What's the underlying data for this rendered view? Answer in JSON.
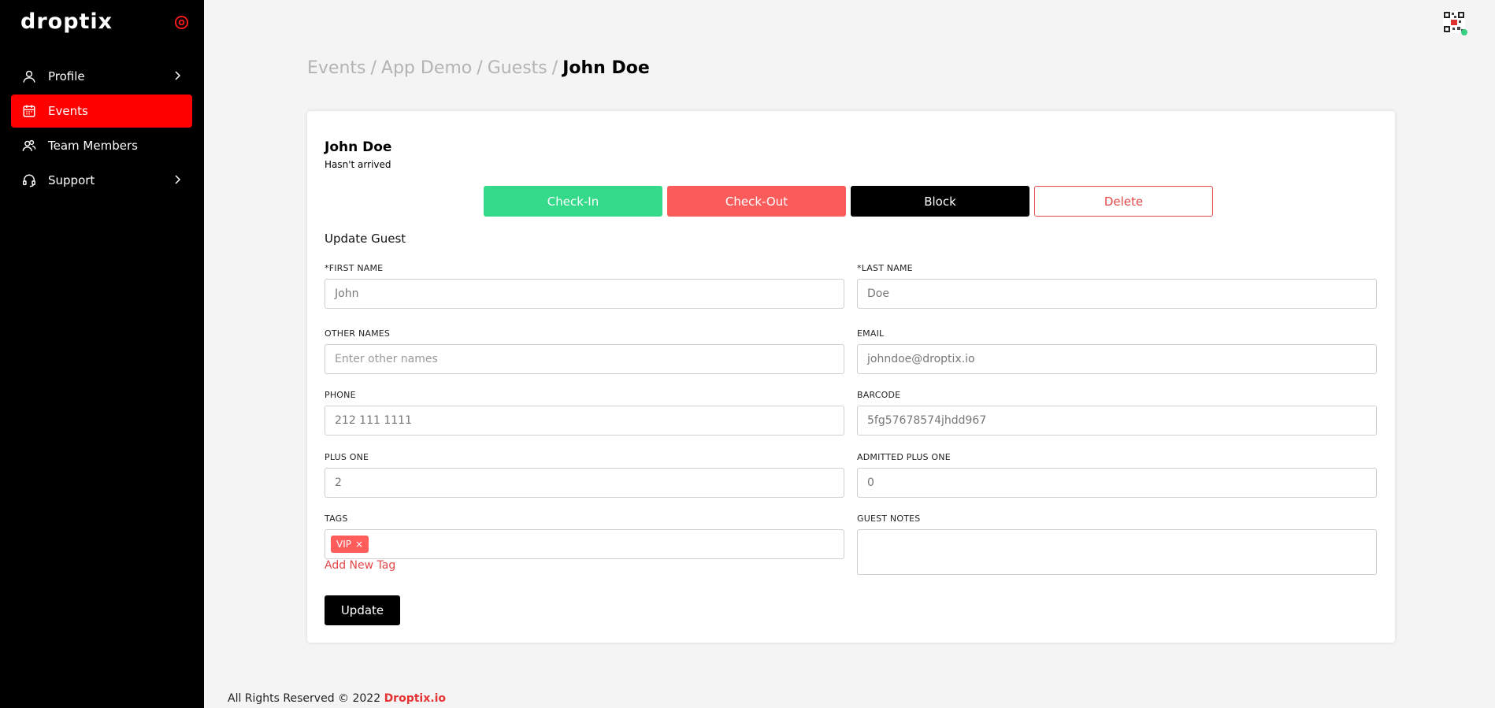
{
  "app": {
    "logo_text": "droptix"
  },
  "sidebar": {
    "items": [
      {
        "label": "Profile",
        "icon": "user-icon",
        "has_chevron": true,
        "active": false
      },
      {
        "label": "Events",
        "icon": "calendar-icon",
        "has_chevron": false,
        "active": true
      },
      {
        "label": "Team Members",
        "icon": "team-icon",
        "has_chevron": false,
        "active": false
      },
      {
        "label": "Support",
        "icon": "headset-icon",
        "has_chevron": true,
        "active": false
      }
    ]
  },
  "breadcrumb": {
    "items": [
      "Events",
      "App Demo",
      "Guests"
    ],
    "current": "John Doe",
    "separator": "/"
  },
  "guest": {
    "name": "John Doe",
    "status": "Hasn't arrived"
  },
  "actions": {
    "checkin_label": "Check-In",
    "checkout_label": "Check-Out",
    "block_label": "Block",
    "delete_label": "Delete"
  },
  "form": {
    "title": "Update Guest",
    "first_name": {
      "label": "*FIRST NAME",
      "value": "John"
    },
    "last_name": {
      "label": "*LAST NAME",
      "value": "Doe"
    },
    "other_names": {
      "label": "OTHER NAMES",
      "placeholder": "Enter other names"
    },
    "email": {
      "label": "EMAIL",
      "value": "johndoe@droptix.io"
    },
    "phone": {
      "label": "PHONE",
      "value": "212 111 1111"
    },
    "barcode": {
      "label": "BARCODE",
      "value": "5fg57678574jhdd967"
    },
    "plus_one": {
      "label": "PLUS ONE",
      "value": "2"
    },
    "admitted_plus_one": {
      "label": "ADMITTED PLUS ONE",
      "value": "0"
    },
    "tags": {
      "label": "TAGS",
      "items": [
        {
          "label": "VIP",
          "remove": "×"
        }
      ],
      "add_label": "Add New Tag"
    },
    "guest_notes": {
      "label": "GUEST NOTES",
      "value": ""
    },
    "update_label": "Update"
  },
  "footer": {
    "text": "All Rights Reserved © 2022",
    "brand": "Droptix.io"
  },
  "colors": {
    "accent": "#ff0000",
    "checkin": "#35d98a",
    "checkout": "#fa5c5c",
    "online_dot": "#35d07f"
  }
}
